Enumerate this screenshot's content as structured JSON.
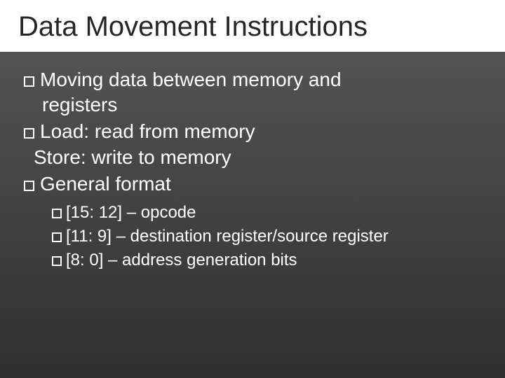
{
  "title": "Data Movement Instructions",
  "bullets": {
    "b1a": "Moving data between memory and",
    "b1b": "registers",
    "b2": "Load: read from memory",
    "b2s": "Store: write to memory",
    "b3": "General format"
  },
  "sub": {
    "s1": "[15: 12] – opcode",
    "s2": "[11: 9] – destination register/source register",
    "s3": "[8: 0] – address generation bits"
  }
}
